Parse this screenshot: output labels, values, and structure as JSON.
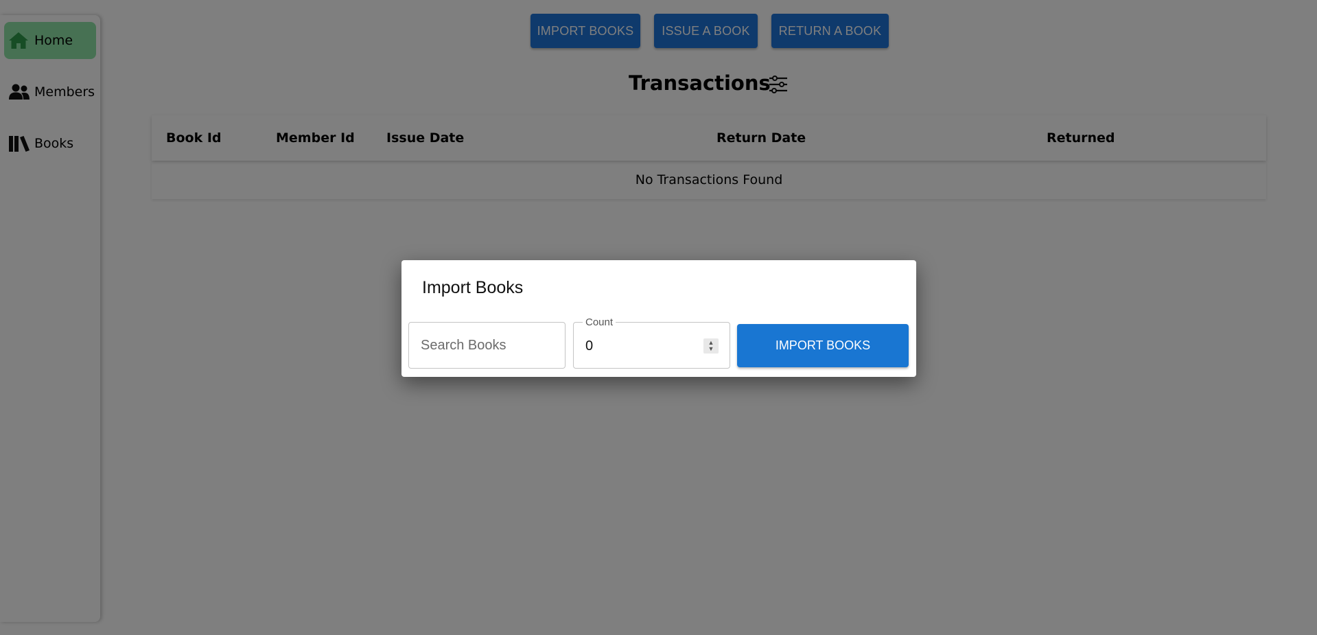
{
  "sidebar": {
    "items": [
      {
        "label": "Home",
        "icon": "home-icon",
        "active": true
      },
      {
        "label": "Members",
        "icon": "users-icon",
        "active": false
      },
      {
        "label": "Books",
        "icon": "books-icon",
        "active": false
      }
    ]
  },
  "toolbar": {
    "import_label": "IMPORT BOOKS",
    "issue_label": "ISSUE A BOOK",
    "return_label": "RETURN A BOOK"
  },
  "main": {
    "title": "Transactions",
    "filter_icon": "sliders-icon",
    "columns": [
      "Book Id",
      "Member Id",
      "Issue Date",
      "Return Date",
      "Returned"
    ],
    "empty_message": "No Transactions Found"
  },
  "modal": {
    "title": "Import Books",
    "search_placeholder": "Search Books",
    "count_label": "Count",
    "count_value": "0",
    "submit_label": "IMPORT BOOKS"
  },
  "colors": {
    "accent": "#1976d2",
    "active_nav": "#8fe3a6",
    "overlay": "rgba(0,0,0,0.5)"
  }
}
